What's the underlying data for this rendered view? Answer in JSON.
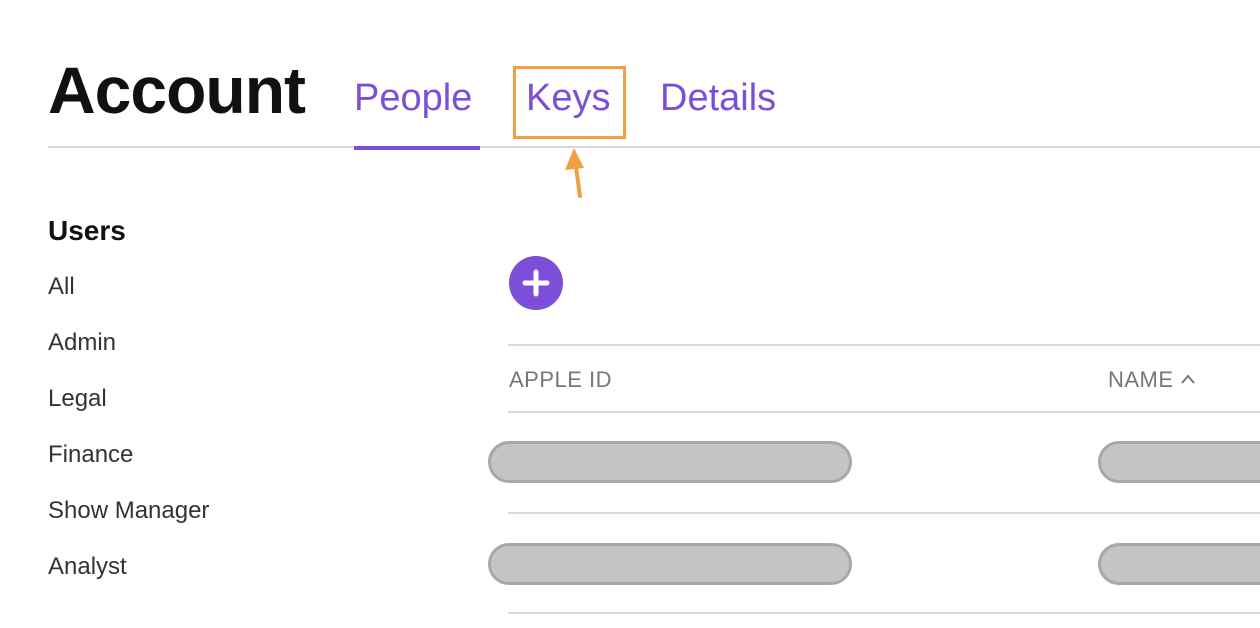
{
  "header": {
    "title": "Account",
    "tabs": [
      {
        "label": "People",
        "active": true
      },
      {
        "label": "Keys",
        "active": false
      },
      {
        "label": "Details",
        "active": false
      }
    ]
  },
  "sidebar": {
    "heading": "Users",
    "items": [
      {
        "label": "All"
      },
      {
        "label": "Admin"
      },
      {
        "label": "Legal"
      },
      {
        "label": "Finance"
      },
      {
        "label": "Show Manager"
      },
      {
        "label": "Analyst"
      }
    ]
  },
  "table": {
    "columns": [
      {
        "label": "APPLE ID"
      },
      {
        "label": "NAME",
        "sort": "ascending"
      }
    ],
    "rows": [
      {
        "apple_id": "",
        "name": ""
      },
      {
        "apple_id": "",
        "name": ""
      }
    ]
  },
  "icons": {
    "add": "plus-icon",
    "sort": "chevron-up-icon",
    "callout": "arrow-up-icon"
  },
  "colors": {
    "accent": "#7b4fd8",
    "highlight": "#f0a040",
    "redacted": "#c4c4c4"
  }
}
